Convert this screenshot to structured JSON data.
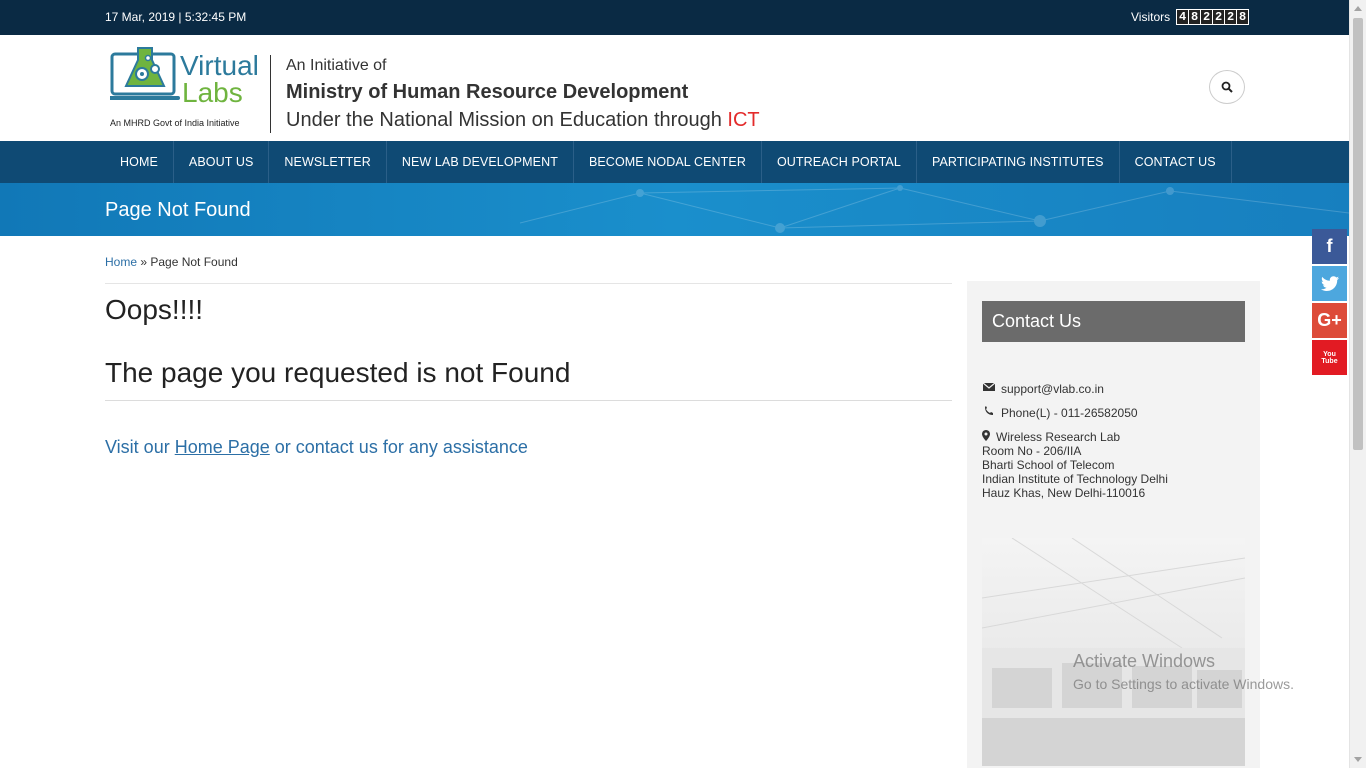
{
  "topbar": {
    "datetime": "17 Mar, 2019 | 5:32:45 PM",
    "visitors_label": "Visitors",
    "visitor_digits": [
      "4",
      "8",
      "2",
      "2",
      "2",
      "8"
    ]
  },
  "logo": {
    "brand_line1": "Virtual",
    "brand_line2": "Labs",
    "tagline": "An MHRD Govt of India Initiative"
  },
  "header": {
    "line1": "An Initiative of",
    "line2": "Ministry of Human Resource Development",
    "line3_prefix": "Under the National Mission on Education through ",
    "line3_highlight": "ICT",
    "highlight_color": "#e32b2b"
  },
  "nav": {
    "items": [
      "HOME",
      "ABOUT US",
      "NEWSLETTER",
      "NEW LAB DEVELOPMENT",
      "BECOME NODAL CENTER",
      "OUTREACH PORTAL",
      "PARTICIPATING INSTITUTES",
      "CONTACT US"
    ]
  },
  "page": {
    "title": "Page Not Found",
    "breadcrumb_home": "Home",
    "breadcrumb_sep": " » ",
    "breadcrumb_current": "Page Not Found",
    "heading1": "Oops!!!!",
    "heading2": "The page you requested is not Found",
    "visit_prefix": "Visit our ",
    "visit_link": "Home Page",
    "visit_suffix": " or contact us for any assistance"
  },
  "sidebar": {
    "title": "Contact Us",
    "email": "support@vlab.co.in",
    "phone": "Phone(L) - 011-26582050",
    "address_lines": [
      "Wireless Research Lab",
      "Room No - 206/IIA",
      "Bharti School of Telecom",
      "Indian Institute of Technology Delhi",
      "Hauz Khas, New Delhi-110016"
    ]
  },
  "social": {
    "facebook": "f",
    "twitter": "t",
    "googleplus": "G+",
    "youtube": "You Tube"
  },
  "watermark": {
    "title": "Activate Windows",
    "subtitle": "Go to Settings to activate Windows."
  },
  "colors": {
    "topbar": "#0a2a44",
    "nav": "#0f4a74",
    "titleband": "#1a8fcc",
    "link": "#2c6fa6"
  }
}
